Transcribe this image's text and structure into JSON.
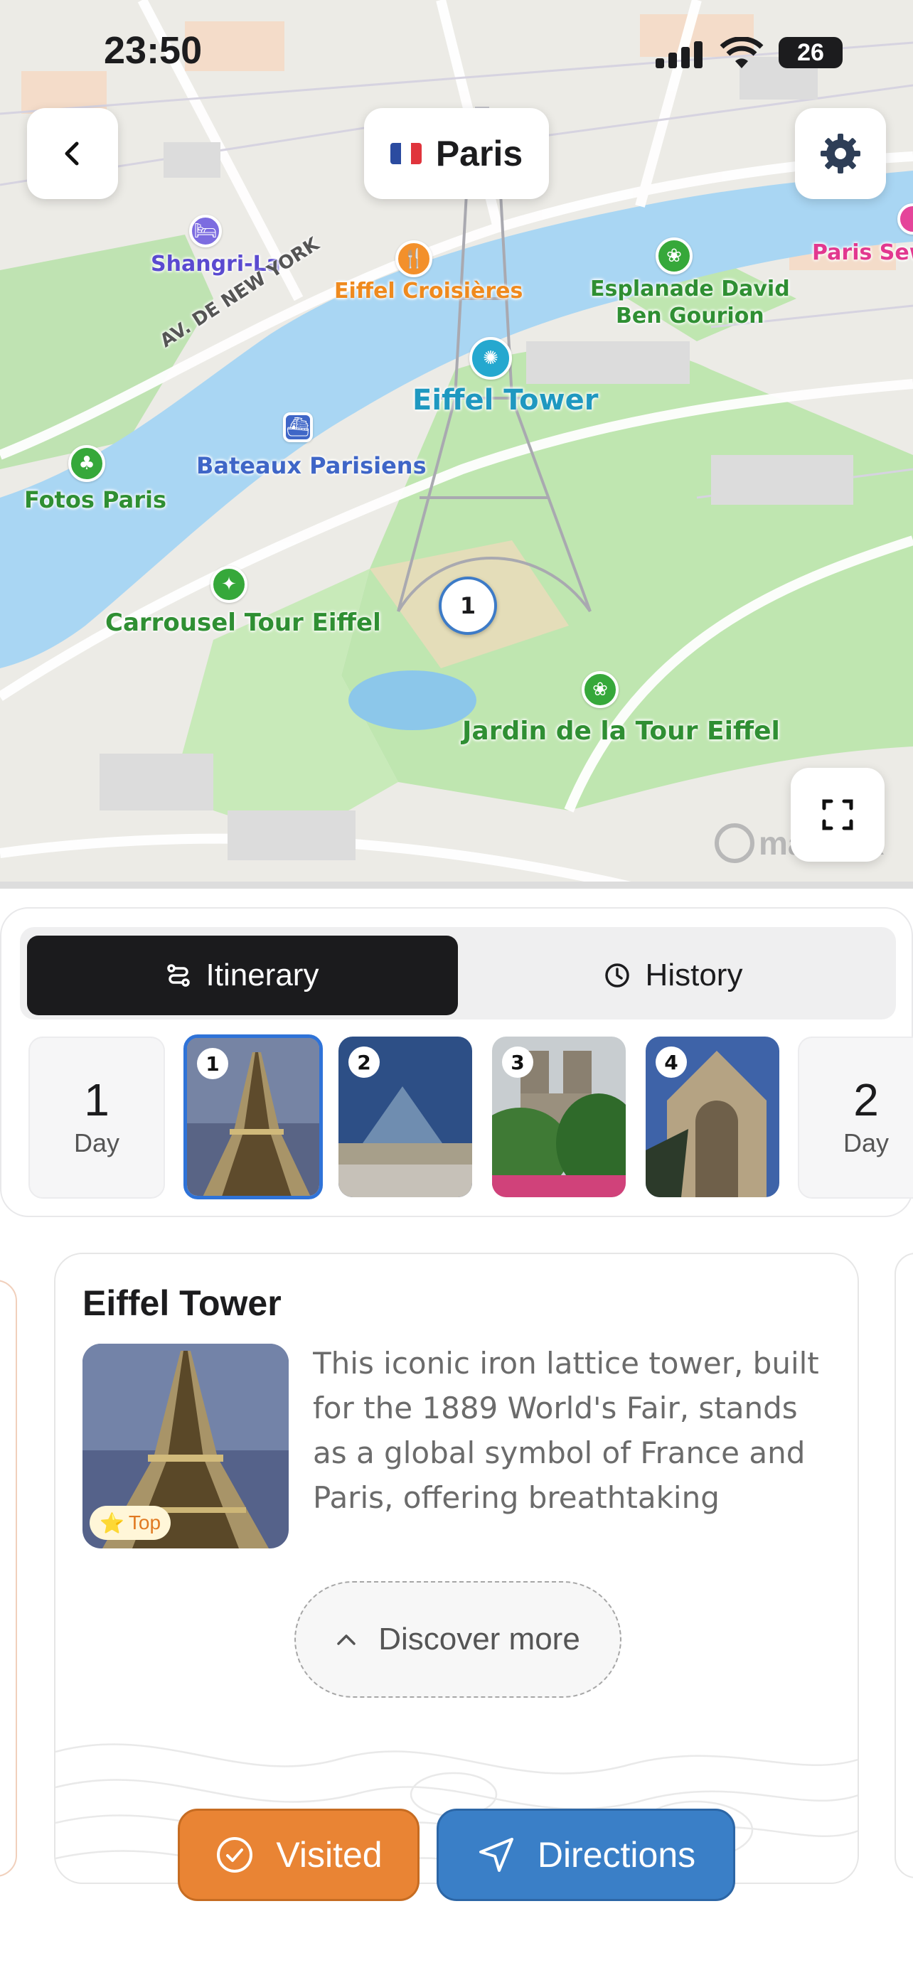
{
  "status_bar": {
    "time": "23:50",
    "battery": "26"
  },
  "header": {
    "city": "Paris",
    "flag": [
      "#2b4ba0",
      "#ffffff",
      "#e0343c"
    ]
  },
  "map": {
    "labels": {
      "shangri_la": "Shangri-La",
      "eiffel_croisieres": "Eiffel Croisières",
      "esplanade": "Esplanade David\nBen Gourion",
      "paris_sewers": "Paris Sewe",
      "av_new_york": "AV. DE NEW YORK",
      "eiffel_tower": "Eiffel Tower",
      "bateaux": "Bateaux Parisiens",
      "fotos": "Fotos Paris",
      "carrousel": "Carrousel Tour Eiffel",
      "jardin": "Jardin de la Tour Eiffel"
    },
    "marker": "1",
    "attribution": "mapbox"
  },
  "tabs": {
    "itinerary": "Itinerary",
    "history": "History"
  },
  "days": {
    "day1_number": "1",
    "day1_label": "Day",
    "day2_number": "2",
    "day2_label": "Day",
    "stops": [
      "1",
      "2",
      "3",
      "4"
    ]
  },
  "place": {
    "title": "Eiffel Tower",
    "badge": "Top",
    "description": "This iconic iron lattice tower, built for the 1889 World's Fair, stands as a global symbol of France and Paris, offering breathtaking panor…",
    "discover": "Discover more"
  },
  "actions": {
    "visited": "Visited",
    "directions": "Directions"
  },
  "colors": {
    "accent_orange": "#e98434",
    "accent_blue": "#3a7fc7",
    "selection": "#2f73d8"
  }
}
